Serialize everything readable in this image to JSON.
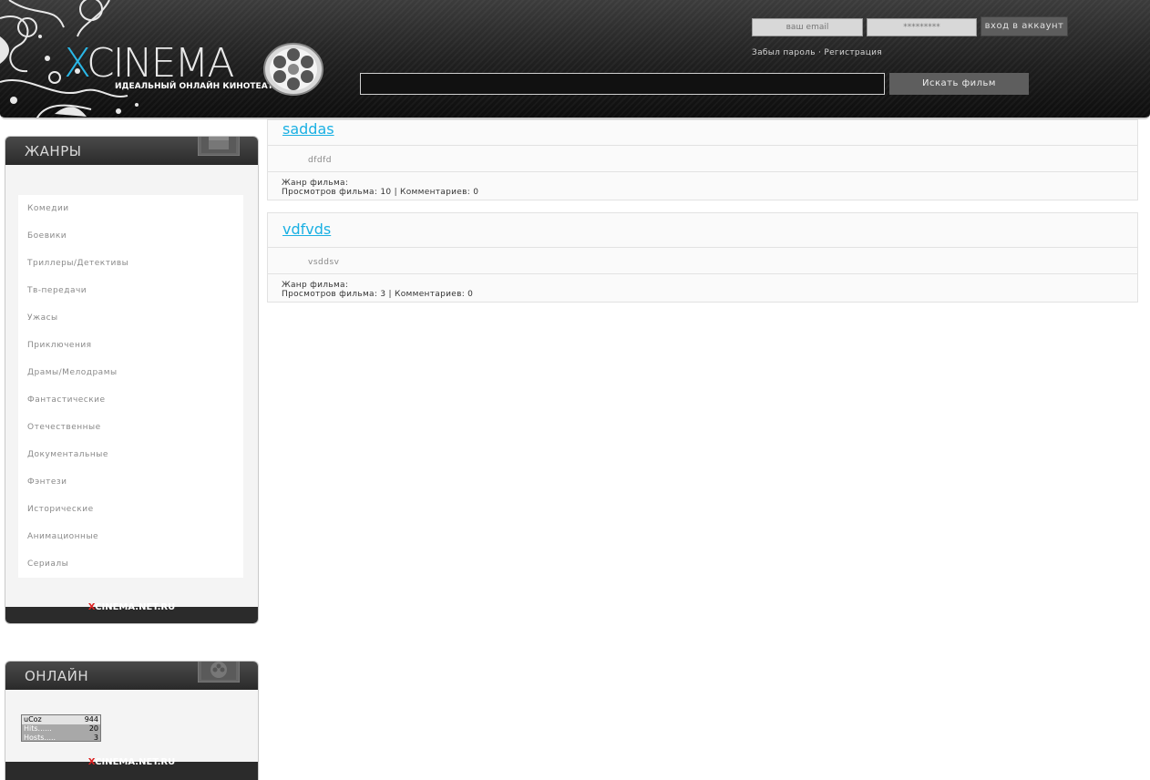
{
  "header": {
    "logo_x": "X",
    "logo_rest": "CINEMA",
    "tagline": "ИДЕАЛЬНЫЙ ОНЛАЙН КИНОТЕАТР",
    "email_placeholder": "ваш email",
    "password_placeholder": "*********",
    "login_label": "вход в аккаунт",
    "forgot_label": "Забыл пароль",
    "separator": "·",
    "register_label": "Регистрация",
    "search_value": "",
    "search_button": "Искать фильм"
  },
  "genres_box": {
    "title": "ЖАНРЫ",
    "items": [
      "Комедии",
      "Боевики",
      "Триллеры/Детективы",
      "Тв-передачи",
      "Ужасы",
      "Приключения",
      "Драмы/Мелодрамы",
      "Фантастические",
      "Отечественные",
      "Документальные",
      "Фэнтези",
      "Исторические",
      "Анимационные",
      "Сериалы"
    ],
    "footer_x": "X",
    "footer_rest": "CINEMA.NET.RU"
  },
  "online_box": {
    "title": "ОНЛАЙН",
    "counter": {
      "brand": "uCoz",
      "total": "944",
      "hits_label": "Hits......",
      "hits": "20",
      "hosts_label": "Hosts.....",
      "hosts": "3"
    },
    "footer_x": "X",
    "footer_rest": "CINEMA.NET.RU"
  },
  "movies": [
    {
      "title": "saddas",
      "desc": "dfdfd",
      "genre_line": "Жанр фильма:",
      "stats_line": "Просмотров фильма: 10 | Комментариев: 0"
    },
    {
      "title": "vdfvds",
      "desc": "vsddsv",
      "genre_line": "Жанр фильма:",
      "stats_line": "Просмотров фильма: 3 | Комментариев: 0"
    }
  ],
  "colors": {
    "accent": "#1ab0e3",
    "header_bg": "#1f1f1f",
    "brand_x": "#d22222"
  }
}
